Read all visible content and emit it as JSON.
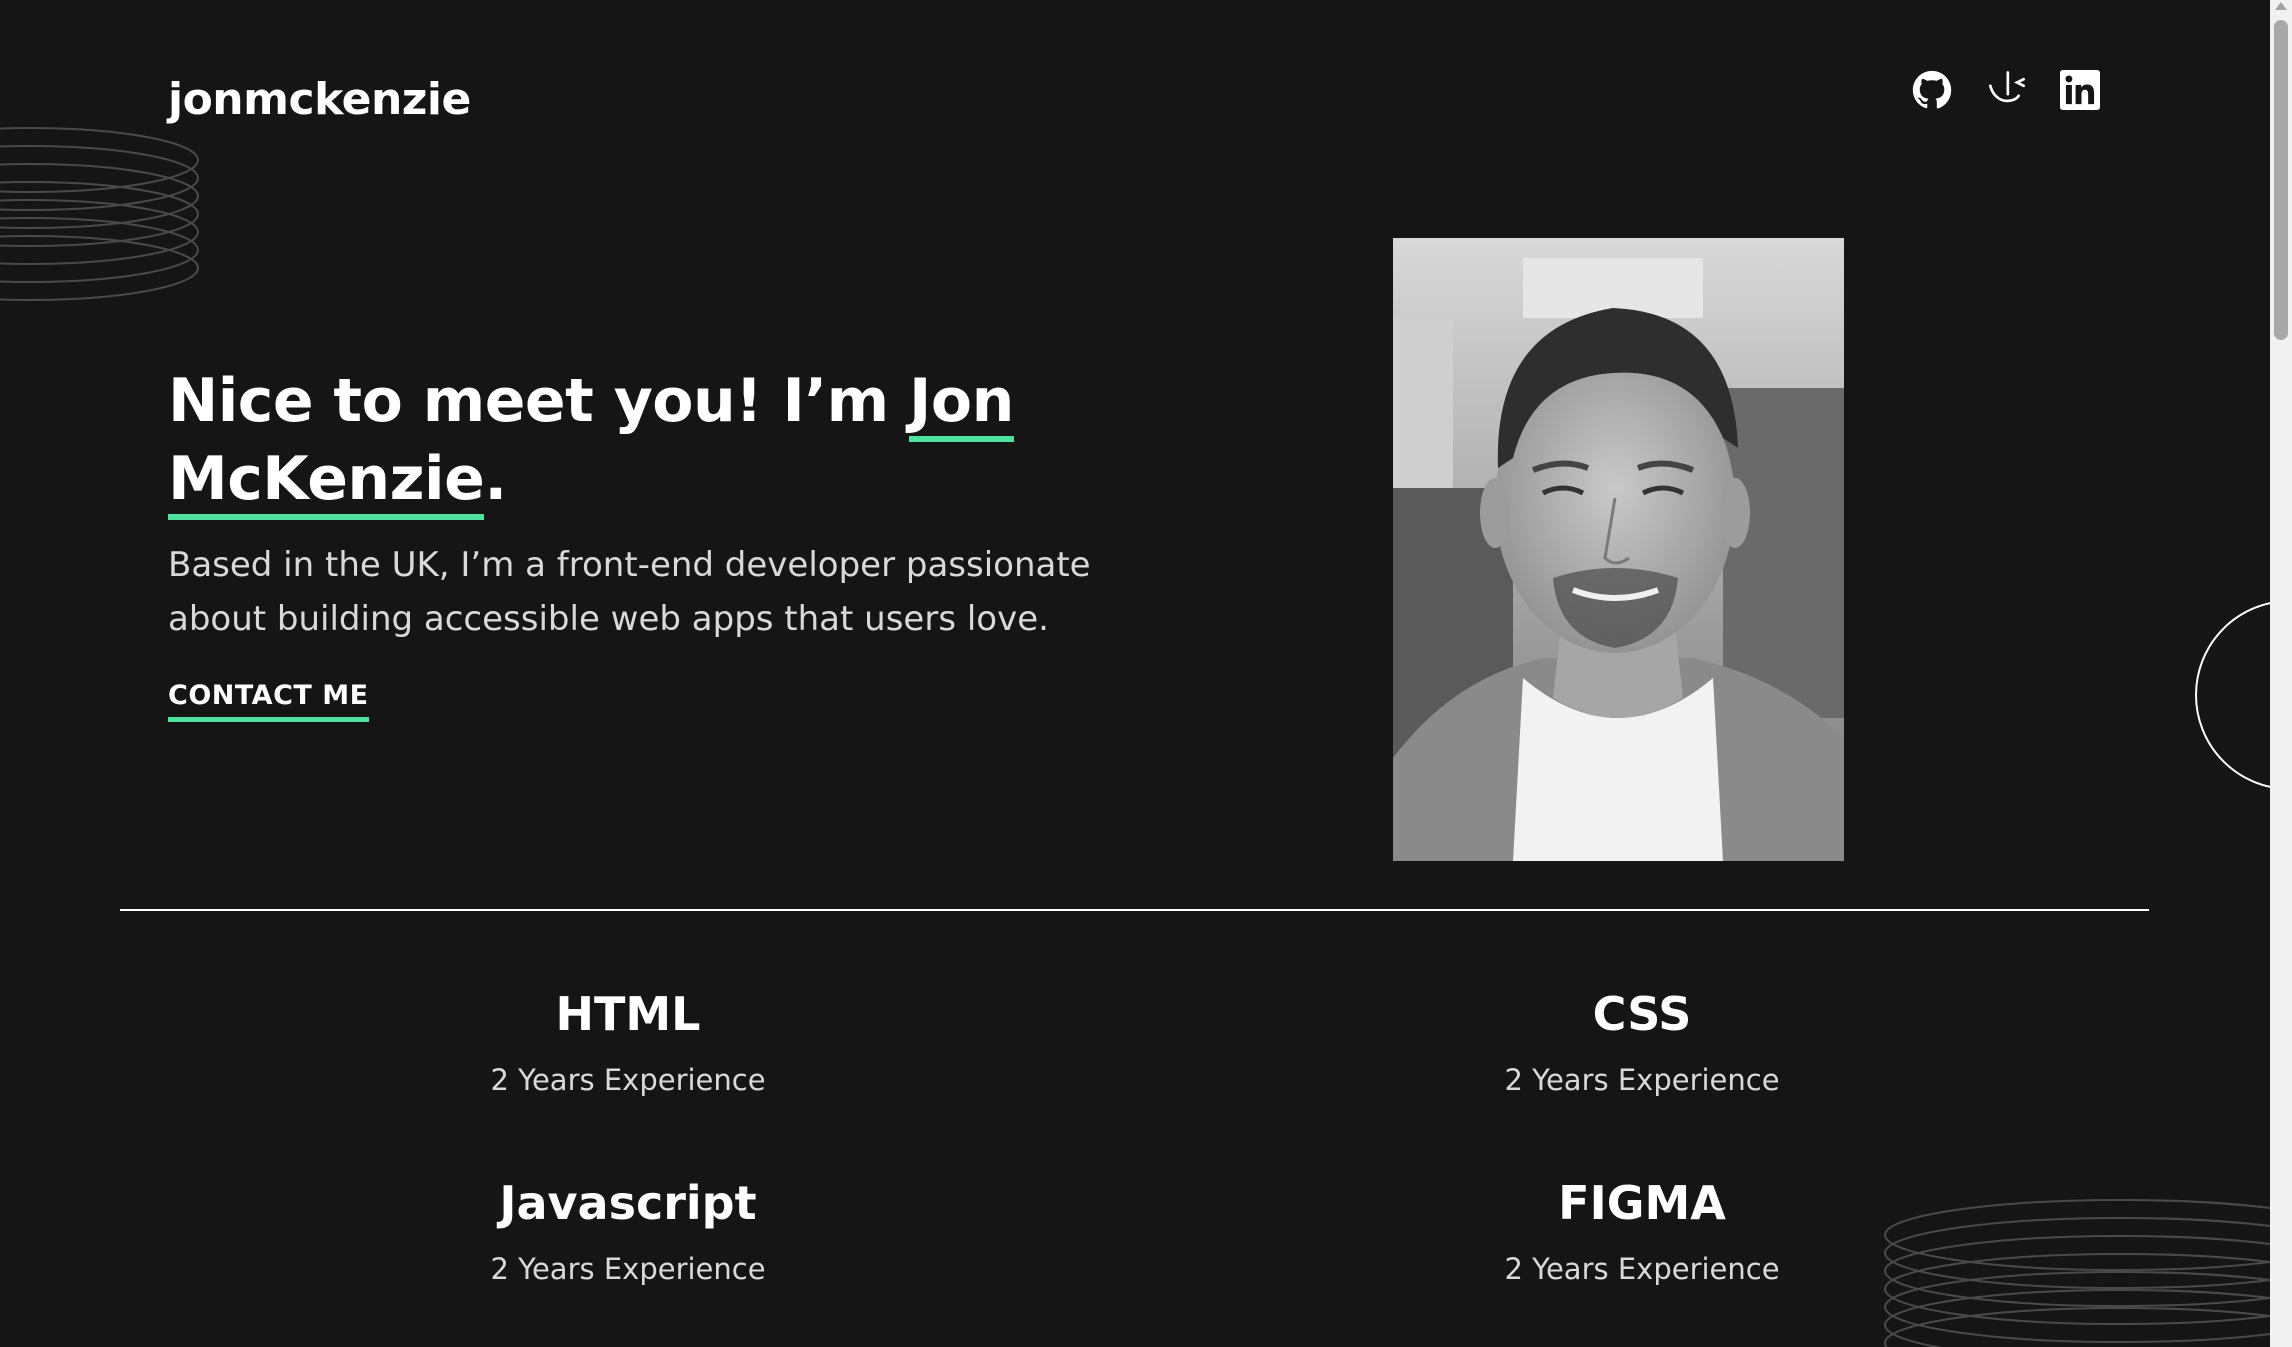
{
  "header": {
    "logo": "jonmckenzie",
    "social": [
      {
        "name": "GitHub",
        "icon": "github-icon"
      },
      {
        "name": "Frontend Mentor",
        "icon": "frontend-mentor-icon"
      },
      {
        "name": "LinkedIn",
        "icon": "linkedin-icon"
      }
    ]
  },
  "hero": {
    "headline_prefix": "Nice to meet you! I’m ",
    "headline_name_first": "Jon",
    "headline_name_last": "McKenzie",
    "headline_suffix": ".",
    "intro": "Based in the UK, I’m a front-end developer passionate about building accessible web apps that users love.",
    "cta": "CONTACT ME",
    "portrait_alt": "Jon McKenzie portrait"
  },
  "skills": [
    {
      "name": "HTML",
      "experience": "2 Years Experience"
    },
    {
      "name": "CSS",
      "experience": "2 Years Experience"
    },
    {
      "name": "Javascript",
      "experience": "2 Years Experience"
    },
    {
      "name": "FIGMA",
      "experience": "2 Years Experience"
    }
  ],
  "colors": {
    "background": "#151515",
    "accent": "#4ee1a0",
    "text": "#ffffff",
    "muted": "#d9d9d9"
  }
}
